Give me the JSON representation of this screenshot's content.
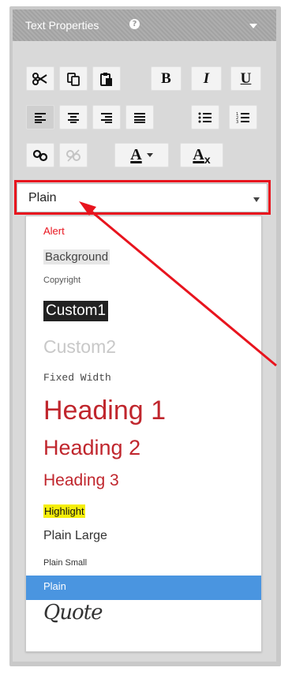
{
  "panel": {
    "title": "Text Properties",
    "help_icon": "question-circle-icon",
    "collapse_icon": "caret-down-icon"
  },
  "toolbar": {
    "bold_label": "B",
    "italic_label": "I",
    "underline_label": "U",
    "font_color_label": "A",
    "clear_format_label": "A",
    "clear_format_sub": "x"
  },
  "style_select": {
    "value": "Plain"
  },
  "style_options": [
    {
      "label": "Alert",
      "color": "#e8141e"
    },
    {
      "label": "Background",
      "color": "#444444",
      "bg": "#e6e6e6"
    },
    {
      "label": "Copyright",
      "color": "#555555"
    },
    {
      "label": "Custom1",
      "color": "#ffffff",
      "bg": "#222222"
    },
    {
      "label": "Custom2",
      "color": "#c8c8c8"
    },
    {
      "label": "Fixed Width",
      "color": "#444444"
    },
    {
      "label": "Heading 1",
      "color": "#c0262d"
    },
    {
      "label": "Heading 2",
      "color": "#c0262d"
    },
    {
      "label": "Heading 3",
      "color": "#c0262d"
    },
    {
      "label": "Highlight",
      "color": "#111111",
      "bg": "#f5ee0a"
    },
    {
      "label": "Plain Large",
      "color": "#333333"
    },
    {
      "label": "Plain Small",
      "color": "#333333"
    },
    {
      "label": "Plain",
      "color": "#ffffff",
      "bg": "#4a95e0",
      "selected": true
    },
    {
      "label": "Quote",
      "color": "#333333"
    }
  ],
  "colors": {
    "header": "#a9a9a9",
    "panel_bg": "#d9d9d9",
    "annotation_red": "#e8141e",
    "selected_blue": "#4a95e0"
  }
}
